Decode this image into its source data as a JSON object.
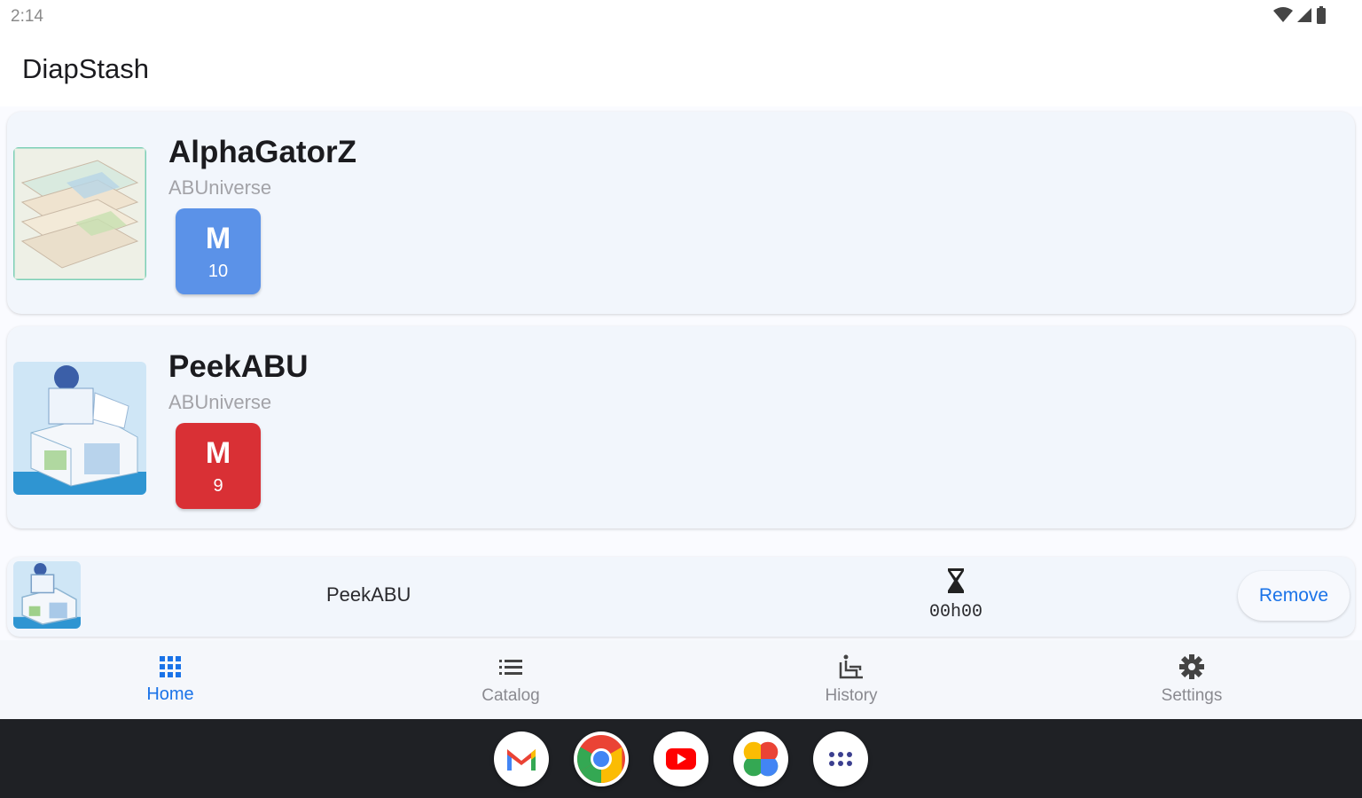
{
  "status": {
    "time": "2:14"
  },
  "app": {
    "title": "DiapStash"
  },
  "products": [
    {
      "name": "AlphaGatorZ",
      "brand": "ABUniverse",
      "size": "M",
      "count": "10",
      "color": "#5b92e8"
    },
    {
      "name": "PeekABU",
      "brand": "ABUniverse",
      "size": "M",
      "count": "9",
      "color": "#d93035"
    }
  ],
  "current": {
    "name": "PeekABU",
    "elapsed": "00h00",
    "remove_label": "Remove"
  },
  "nav": {
    "items": [
      {
        "label": "Home",
        "icon": "grid-icon",
        "active": true
      },
      {
        "label": "Catalog",
        "icon": "list-icon",
        "active": false
      },
      {
        "label": "History",
        "icon": "history-icon",
        "active": false
      },
      {
        "label": "Settings",
        "icon": "gear-icon",
        "active": false
      }
    ]
  },
  "dock": [
    "gmail-icon",
    "chrome-icon",
    "youtube-icon",
    "photos-icon",
    "app-drawer-icon"
  ],
  "colors": {
    "accent": "#1a73e8",
    "card": "#f2f6fc"
  }
}
